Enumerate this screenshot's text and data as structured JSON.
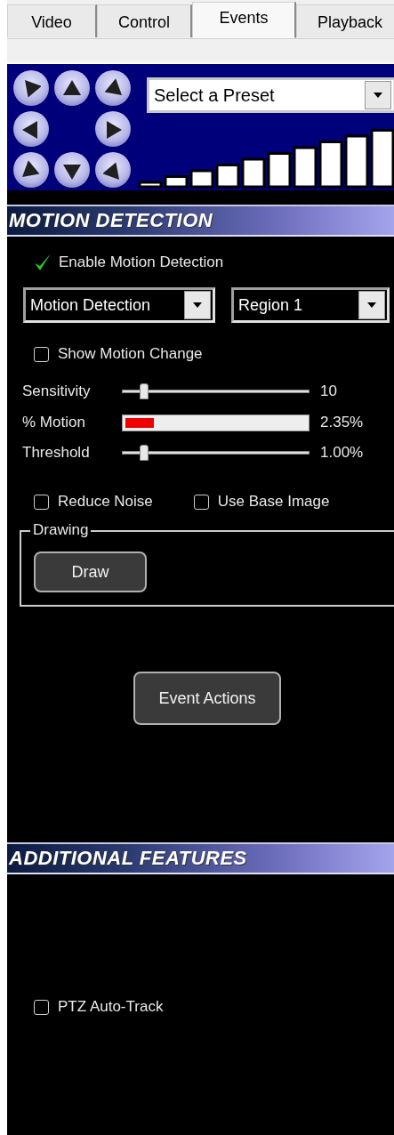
{
  "tabs": [
    {
      "label": "Video",
      "selected": false
    },
    {
      "label": "Control",
      "selected": false
    },
    {
      "label": "Events",
      "selected": true
    },
    {
      "label": "Playback",
      "selected": false
    }
  ],
  "ptz": {
    "preset": {
      "value": "Select a Preset"
    }
  },
  "motion_detection": {
    "title": "MOTION DETECTION",
    "enable": {
      "label": "Enable Motion Detection",
      "checked": true
    },
    "dropdowns": [
      {
        "value": "Motion Detection"
      },
      {
        "value": "Region 1"
      }
    ],
    "show_change": {
      "label": "Show Motion Change",
      "checked": false
    },
    "meters": [
      {
        "kind": "slider",
        "label": "Sensitivity",
        "level": 0.12,
        "reading": "10"
      },
      {
        "kind": "bar",
        "label": "% Motion",
        "level": 0.16,
        "reading": "2.35%"
      },
      {
        "kind": "slider",
        "label": "Threshold",
        "level": 0.12,
        "reading": "1.00%"
      }
    ],
    "options": [
      {
        "label": "Reduce Noise",
        "checked": false
      },
      {
        "label": "Use Base Image",
        "checked": false
      }
    ],
    "drawing": {
      "legend": "Drawing",
      "button": "Draw"
    },
    "event_actions": "Event Actions"
  },
  "additional_features": {
    "title": "ADDITIONAL FEATURES",
    "options": [
      {
        "label": "PTZ Auto-Track",
        "checked": false
      }
    ]
  }
}
